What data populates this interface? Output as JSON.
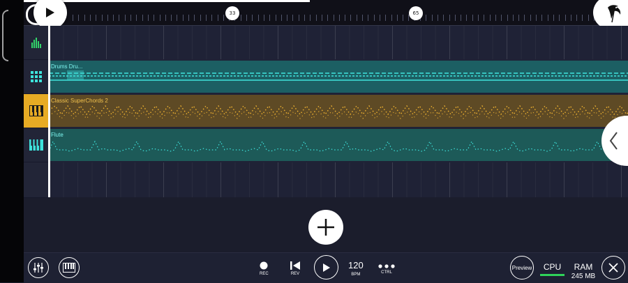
{
  "timeline": {
    "markers": [
      "33",
      "65"
    ]
  },
  "tracks": [
    {
      "icon": "level-meter-icon",
      "label": ""
    },
    {
      "icon": "drum-pads-icon",
      "label": "Drums Dru..."
    },
    {
      "icon": "piano-keys-icon",
      "label": "Classic SuperChords 2",
      "selected": true
    },
    {
      "icon": "keyboard-icon",
      "label": "Flute"
    }
  ],
  "transport": {
    "rec_label": "REC",
    "rev_label": "REV",
    "bpm_value": "120",
    "bpm_label": "BPM",
    "ctrl_label": "CTRL"
  },
  "status": {
    "preview_label": "Preview",
    "cpu_label": "CPU",
    "ram_label": "RAM",
    "ram_value": "245 MB"
  },
  "colors": {
    "selected_track": "#e7ab24",
    "drums_clip": "#1c5f63",
    "chords_clip": "#5e4a25",
    "flute_clip": "#1d5a58",
    "note_cyan": "#3ee3dc",
    "note_orange": "#f2b431",
    "cpu_meter": "#2fd35a"
  }
}
